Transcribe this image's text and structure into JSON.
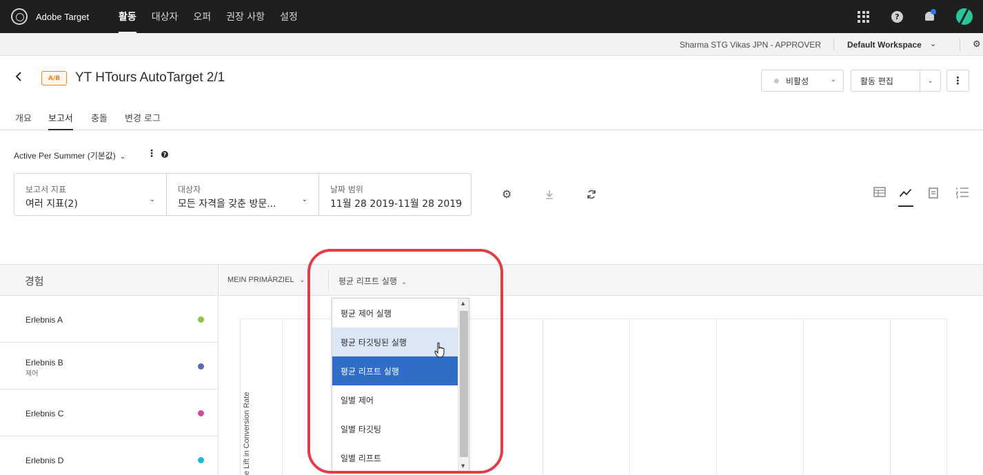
{
  "topnav": {
    "brand": "Adobe Target",
    "items": [
      "활동",
      "대상자",
      "오퍼",
      "권장 사항",
      "설정"
    ],
    "active_index": 0,
    "help_glyph": "?"
  },
  "subheader": {
    "user": "Sharma STG Vikas JPN - APPROVER",
    "workspace": "Default Workspace"
  },
  "activity": {
    "type_badge": "A/B",
    "title": "YT HTours AutoTarget 2/1",
    "status": "비활성",
    "edit_label": "활동 편집"
  },
  "tabs": [
    "개요",
    "보고서",
    "충돌",
    "변경 로그"
  ],
  "active_tab": 1,
  "report": {
    "name": "Active Per Summer (기본값)",
    "help_glyph": "?"
  },
  "filters": [
    {
      "label": "보고서 지표",
      "value": "여러 지표(2)"
    },
    {
      "label": "대상자",
      "value": "모든 자격을 갖춘 방문..."
    },
    {
      "label": "날짜 범위",
      "value": "11월 28 2019-11월 28 2019"
    }
  ],
  "table": {
    "experience_header": "경험",
    "metric_header": "MEIN PRIMÄRZIEL",
    "view_selected": "평균 리프트 실행"
  },
  "experiences": [
    {
      "name": "Erlebnis A",
      "sub": "",
      "color": "#8dc63f"
    },
    {
      "name": "Erlebnis B",
      "sub": "제어",
      "color": "#5a6bb0"
    },
    {
      "name": "Erlebnis C",
      "sub": "",
      "color": "#d6489a"
    },
    {
      "name": "Erlebnis D",
      "sub": "",
      "color": "#21b8d4"
    }
  ],
  "chart": {
    "yaxis_label": "e Lift in Conversion Rate"
  },
  "view_dropdown": {
    "options": [
      "평균 제어 실행",
      "평균 타깃팅된 실행",
      "평균 리프트 실행",
      "일별 제어",
      "일별 타깃팅",
      "일별 리프트"
    ],
    "hovered_index": 1,
    "selected_index": 2
  },
  "colors": {
    "accent": "#2f6dc8",
    "highlight_ring": "#e23c46",
    "ab_badge": "#e68619"
  }
}
